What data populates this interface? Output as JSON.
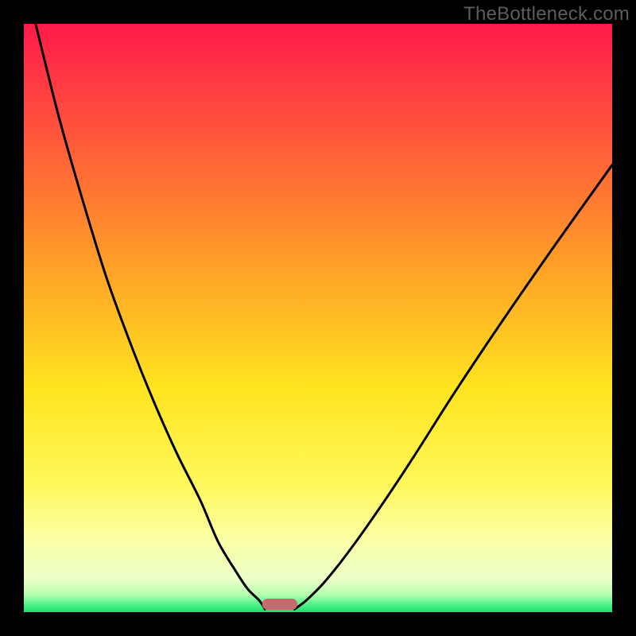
{
  "watermark": "TheBottleneck.com",
  "chart_data": {
    "type": "line",
    "title": "",
    "xlabel": "",
    "ylabel": "",
    "xlim": [
      0,
      100
    ],
    "ylim": [
      0,
      100
    ],
    "grid": false,
    "legend": false,
    "series": [
      {
        "name": "left-curve",
        "x": [
          2,
          6,
          10,
          14,
          18,
          22,
          26,
          30,
          33,
          36,
          38,
          40,
          41
        ],
        "values": [
          100,
          84,
          70,
          57,
          46,
          36,
          27,
          19,
          12,
          7,
          4,
          2,
          0.5
        ]
      },
      {
        "name": "right-curve",
        "x": [
          46,
          48,
          51,
          55,
          60,
          66,
          73,
          81,
          90,
          100
        ],
        "values": [
          0.5,
          2,
          5,
          10,
          17,
          26,
          37,
          49,
          62,
          76
        ]
      }
    ],
    "marker": {
      "name": "optimum-marker",
      "x_center": 43.5,
      "width": 6,
      "color": "#c76a6f"
    },
    "background_gradient": {
      "stops": [
        {
          "offset": 0.0,
          "color": "#ff1a4b"
        },
        {
          "offset": 0.2,
          "color": "#ff5a3a"
        },
        {
          "offset": 0.42,
          "color": "#ffa327"
        },
        {
          "offset": 0.62,
          "color": "#ffe41f"
        },
        {
          "offset": 0.78,
          "color": "#fff85a"
        },
        {
          "offset": 0.88,
          "color": "#fbffa8"
        },
        {
          "offset": 0.945,
          "color": "#eaffc8"
        },
        {
          "offset": 0.97,
          "color": "#b5ffb0"
        },
        {
          "offset": 0.985,
          "color": "#5cf58f"
        },
        {
          "offset": 1.0,
          "color": "#18e06f"
        }
      ]
    }
  }
}
